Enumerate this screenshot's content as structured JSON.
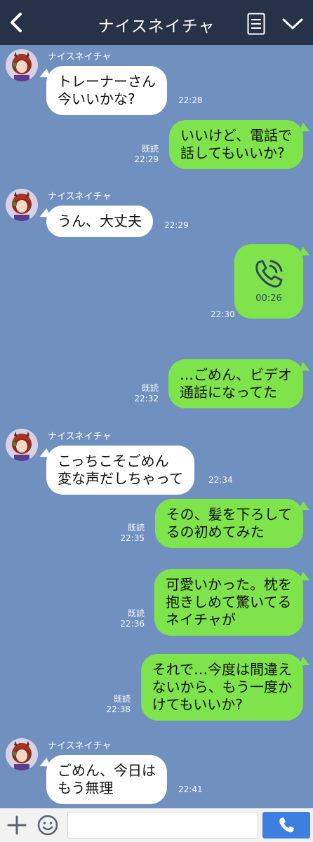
{
  "header": {
    "title": "ナイスネイチャ"
  },
  "messages": [
    {
      "sender": "ナイスネイチャ",
      "lines": [
        "トレーナーさん",
        "今いいかな?"
      ],
      "time": "22:28"
    },
    {
      "lines": [
        "いいけど、電話で",
        "話してもいいか?"
      ],
      "read": "既読",
      "time": "22:29"
    },
    {
      "sender": "ナイスネイチャ",
      "lines": [
        "うん、大丈夫"
      ],
      "time": "22:29"
    },
    {
      "call_duration": "00:26",
      "time": "22:30"
    },
    {
      "lines": [
        "…ごめん、ビデオ",
        "通話になってた"
      ],
      "read": "既読",
      "time": "22:32"
    },
    {
      "sender": "ナイスネイチャ",
      "lines": [
        "こっちこそごめん",
        "変な声だしちゃって"
      ],
      "time": "22:34"
    },
    {
      "lines": [
        "その、髪を下ろして",
        "るの初めてみた"
      ],
      "read": "既読",
      "time": "22:35"
    },
    {
      "lines": [
        "可愛いかった。枕を",
        "抱きしめて驚いてる",
        "ネイチャが"
      ],
      "read": "既読",
      "time": "22:36"
    },
    {
      "lines": [
        "それで…今度は間違え",
        "ないから、もう一度か",
        "けてもいいか?"
      ],
      "read": "既読",
      "time": "22:38"
    },
    {
      "sender": "ナイスネイチャ",
      "lines": [
        "ごめん、今日は",
        "もう無理"
      ],
      "time": "22:41"
    }
  ],
  "colors": {
    "background": "#7091c0",
    "header": "#263248",
    "outgoing_bubble": "#7fe34c",
    "incoming_bubble": "#ffffff",
    "send_button": "#3d7fe0"
  },
  "icons": {
    "back": "chevron-left-icon",
    "menu": "list-icon",
    "more": "chevron-down-icon",
    "call": "phone-icon",
    "add": "plus-icon",
    "emoji": "smile-icon",
    "send": "phone-send-icon"
  },
  "footer": {
    "input_value": ""
  }
}
